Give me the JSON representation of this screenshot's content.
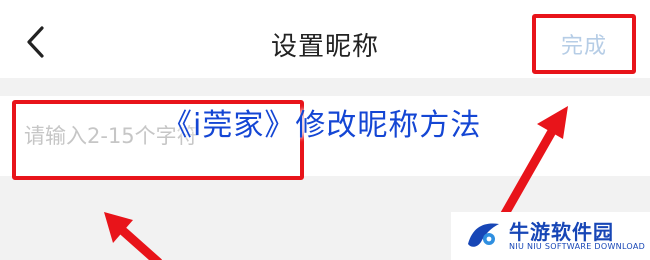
{
  "nav": {
    "back_icon": "chevron-left-icon",
    "title": "设置昵称",
    "done_label": "完成",
    "done_color": "#b6cde6"
  },
  "field": {
    "placeholder": "请输入2-15个字符",
    "value": ""
  },
  "overlay": {
    "caption": "《i莞家》修改昵称方法",
    "caption_color": "#1446d4"
  },
  "annotations": {
    "highlight_color": "#e8141a",
    "arrow_icon": "red-arrow-icon"
  },
  "watermark": {
    "name": "牛游软件园",
    "subtitle": "NIU NIU SOFTWARE DOWNLOAD",
    "brand_color": "#1746b6"
  }
}
